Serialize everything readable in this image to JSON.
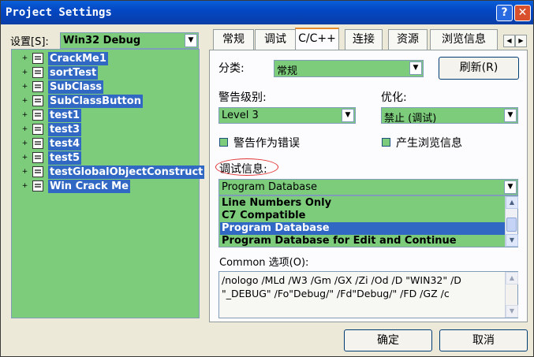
{
  "window": {
    "title": "Project Settings",
    "help_label": "?",
    "close_label": "✕"
  },
  "settings": {
    "label": "设置[S]:",
    "config_value": "Win32 Debug",
    "tree_items": [
      {
        "label": "CrackMe1"
      },
      {
        "label": "sortTest"
      },
      {
        "label": "SubClass"
      },
      {
        "label": "SubClassButton"
      },
      {
        "label": "test1"
      },
      {
        "label": "test3"
      },
      {
        "label": "test4"
      },
      {
        "label": "test5"
      },
      {
        "label": "testGlobalObjectConstruct"
      },
      {
        "label": "Win Crack Me"
      }
    ]
  },
  "tabs": [
    {
      "label": "常规"
    },
    {
      "label": "调试"
    },
    {
      "label": "C/C++",
      "active": true
    },
    {
      "label": "连接"
    },
    {
      "label": "资源"
    },
    {
      "label": "浏览信息"
    }
  ],
  "tab_scroll": {
    "left": "◀",
    "right": "▶"
  },
  "category": {
    "label": "分类:",
    "value": "常规",
    "reset_label": "刷新(R)"
  },
  "warning": {
    "label": "警告级别:",
    "value": "Level 3",
    "as_error_label": "警告作为错误"
  },
  "optimize": {
    "label": "优化:",
    "value": "禁止 (调试)",
    "browse_label": "产生浏览信息"
  },
  "debug_info": {
    "label": "调试信息:",
    "value": "Program Database",
    "options": [
      {
        "label": "Line Numbers Only",
        "selected": false
      },
      {
        "label": "C7 Compatible",
        "selected": false
      },
      {
        "label": "Program Database",
        "selected": true
      },
      {
        "label": "Program Database for Edit and Continue",
        "selected": false
      }
    ]
  },
  "common_options": {
    "label": "Common 选项(O):",
    "text": "/nologo /MLd /W3 /Gm /GX /Zi /Od /D \"WIN32\" /D \"_DEBUG\" /Fo\"Debug/\" /Fd\"Debug/\" /FD /GZ /c"
  },
  "buttons": {
    "ok": "确定",
    "cancel": "取消"
  },
  "icons": {
    "dropdown": "▼",
    "tree_expand": "+",
    "scroll_up": "▲",
    "scroll_down": "▼"
  },
  "colors": {
    "field_bg": "#7ccc7c",
    "selection": "#3168c4",
    "titlebar": "#0347c4",
    "annotation_circle": "#e03030"
  }
}
